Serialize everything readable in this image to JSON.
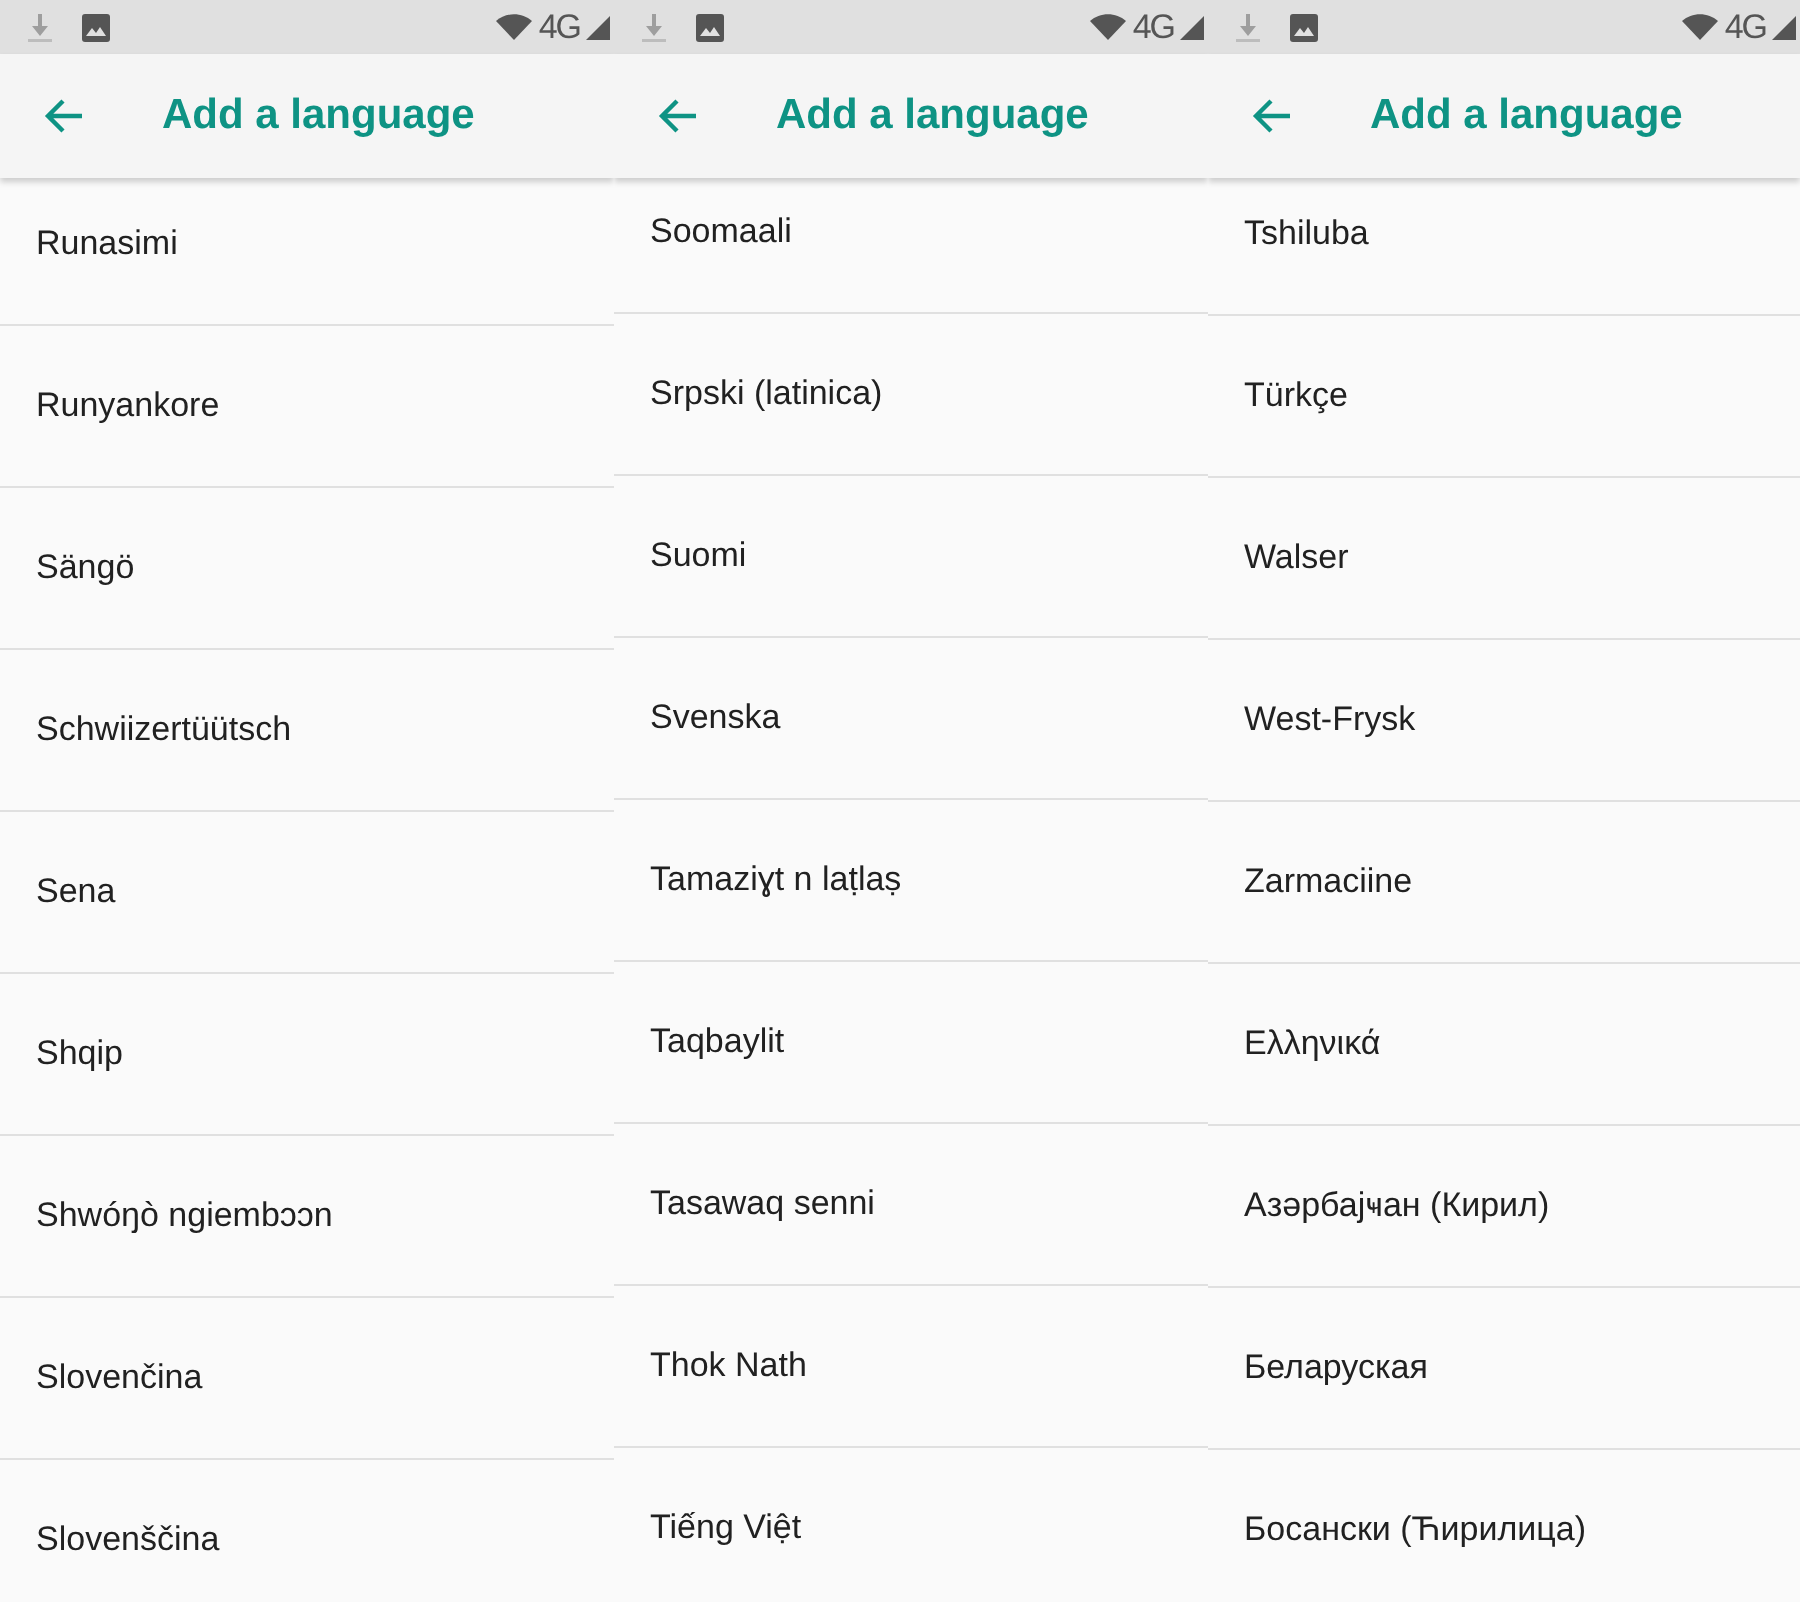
{
  "screens": [
    {
      "status_bar": {
        "network": "4G"
      },
      "app_bar": {
        "title": "Add a language"
      },
      "languages": [
        "Runasimi",
        "Runyankore",
        "Sängö",
        "Schwiizertüütsch",
        "Sena",
        "Shqip",
        "Shwóŋò ngiembɔɔn",
        "Slovenčina",
        "Slovenščina"
      ]
    },
    {
      "status_bar": {
        "network": "4G"
      },
      "app_bar": {
        "title": "Add a language"
      },
      "languages": [
        "Soomaali",
        "Srpski (latinica)",
        "Suomi",
        "Svenska",
        "Tamaziɣt n laṭlaṣ",
        "Taqbaylit",
        "Tasawaq senni",
        "Thok Nath",
        "Tiếng Việt"
      ]
    },
    {
      "status_bar": {
        "network": "4G"
      },
      "app_bar": {
        "title": "Add a language"
      },
      "languages": [
        "Tshiluba",
        "Türkçe",
        "Walser",
        "West-Frysk",
        "Zarmaciine",
        "Ελληνικά",
        "Азәрбајҹан (Кирил)",
        "Беларуская",
        "Босански (Ћирилица)"
      ]
    }
  ]
}
